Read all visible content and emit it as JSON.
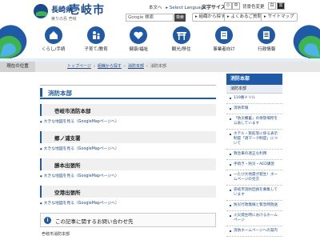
{
  "header": {
    "logo_pref": "長崎県",
    "logo_city": "壱岐市",
    "logo_sub": "実りの島 壱岐",
    "top_links": [
      "本文へ",
      "Select Language"
    ],
    "font_size_label": "文字サイズ",
    "font_size_buttons": [
      "小",
      "中",
      "大"
    ],
    "color_label": "背景色変更",
    "color_buttons": [
      "白",
      "黒"
    ],
    "search_placeholder": "Google 検索",
    "search_button": "検索",
    "util_buttons": [
      "組織から探す",
      "よくあるご質問",
      "サイトマップ"
    ]
  },
  "nav": [
    {
      "label": "くらし/手続",
      "icon": "house-icon"
    },
    {
      "label": "子育て/教育",
      "icon": "family-icon"
    },
    {
      "label": "健康/福祉",
      "icon": "health-icon"
    },
    {
      "label": "観光/移住",
      "icon": "torii-icon"
    },
    {
      "label": "事業者向け",
      "icon": "building-icon"
    },
    {
      "label": "行政情報",
      "icon": "document-icon"
    }
  ],
  "breadcrumb": {
    "title": "現在の位置",
    "items": [
      "トップページ",
      "組織から探す",
      "消防本部",
      "消防本部"
    ]
  },
  "main": {
    "page_title": "消防本部",
    "stations": [
      {
        "name": "壱岐市消防本部",
        "link": "大きな地図を見る（GoogleMapページへ）"
      },
      {
        "name": "郷ノ浦支署",
        "link": "大きな地図を見る（GoogleMapページへ）"
      },
      {
        "name": "勝本出張所",
        "link": "大きな地図を見る（GoogleMapページへ）"
      },
      {
        "name": "空港出張所",
        "link": "大きな地図を見る（GoogleMapページへ）"
      }
    ],
    "inquiry_title": "この記事に関するお問い合わせ先",
    "footer_text": "壱岐市消防本部"
  },
  "sidebar": {
    "head": "消防本部",
    "sub": "消防本部",
    "items": [
      "119番ドリル",
      "消防年報",
      "「防災備蓄」の保管場所を公表しています",
      "ホテル・旅館等に係る表示制度「適マーク制度」について",
      "救急車の適正な利用",
      "手続き・防災・AED講習",
      "一たび大地震が発生！ホームページの見方",
      "壱岐市消防団員を募集しています",
      "防災行政無線と緊急時放送",
      "火災発生時におけるホームページ",
      "消防ホームページへの案内"
    ]
  },
  "colors": {
    "brand_blue": "#1f5aa8",
    "wave_green": "#3db54a",
    "wave_blue": "#4fb3e8"
  }
}
